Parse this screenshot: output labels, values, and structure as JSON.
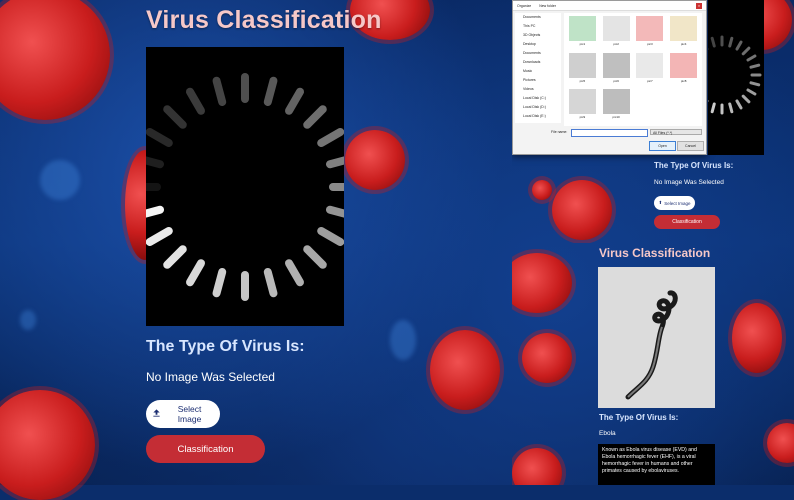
{
  "main": {
    "title": "Virus Classification",
    "type_label": "The Type Of Virus Is:",
    "result": "No Image Was Selected",
    "select_button": "Select Image",
    "classify_button": "Classification"
  },
  "dialog": {
    "breadcrumb_1": "Organize",
    "breadcrumb_2": "New folder",
    "sidebar": [
      "Documents",
      "This PC",
      "3D Objects",
      "Desktop",
      "Documents",
      "Downloads",
      "Music",
      "Pictures",
      "Videos",
      "Local Disk (C:)",
      "Local Disk (D:)",
      "Local Disk (E:)"
    ],
    "thumbnails": [
      "pic1",
      "pic2",
      "pic3",
      "pic4",
      "pic5",
      "pic6",
      "pic7",
      "pic8",
      "pic9",
      "pic10"
    ],
    "file_name_label": "File name:",
    "file_type": "All Files (*.*)",
    "open_button": "Open",
    "cancel_button": "Cancel"
  },
  "right_top": {
    "type_label": "The Type Of Virus Is:",
    "result": "No Image Was Selected",
    "select_button": "Select Image",
    "classify_button": "Classification"
  },
  "right_bottom": {
    "title": "Virus Classification",
    "type_label": "The Type Of Virus Is:",
    "result": "Ebola",
    "description": "Known as Ebola virus disease (EVD) and Ebola hemorrhagic fever (EHF), is a viral hemorrhagic fever in humans and other primates caused by ebolaviruses."
  },
  "colors": {
    "accent_red": "#c42d35",
    "title_pink": "#f6c8c8",
    "bg_blue": "#0b2d6b"
  },
  "icons": {
    "upload": "upload-icon",
    "spinner": "loading-spinner-icon"
  }
}
